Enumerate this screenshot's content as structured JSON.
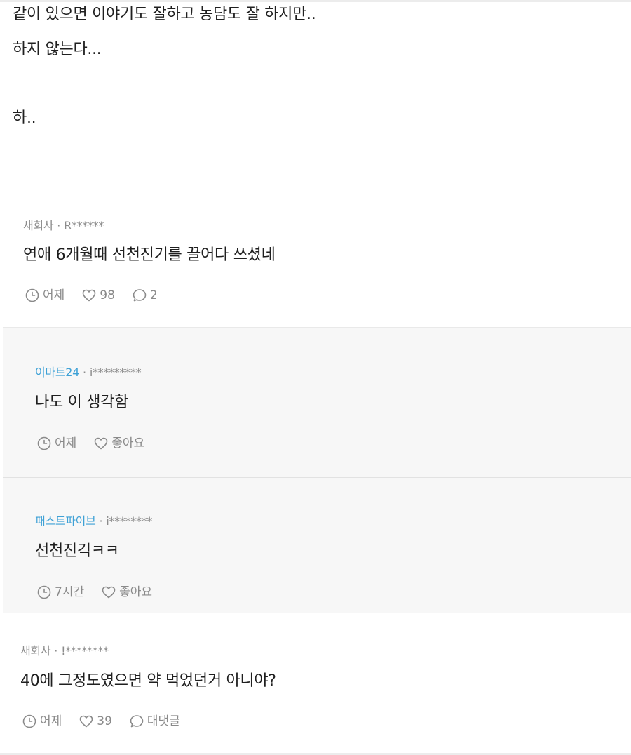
{
  "post": {
    "lines": [
      "같이 있으면 이야기도 잘하고 농담도 잘 하지만..",
      "하지 않는다...",
      "하.."
    ]
  },
  "comments": [
    {
      "company": "새회사",
      "separator": "·",
      "user": "R******",
      "text": "연애 6개월때 선천진기를 끌어다 쓰셨네",
      "time": "어제",
      "likes": "98",
      "replies": "2"
    },
    {
      "company": "이마트24",
      "separator": "·",
      "user": "i*********",
      "text": "나도 이 생각함",
      "time": "어제",
      "likes": "좋아요"
    },
    {
      "company": "패스트파이브",
      "separator": "·",
      "user": "i********",
      "text": "선천진긱ㅋㅋ",
      "time": "7시간",
      "likes": "좋아요"
    },
    {
      "company": "새회사",
      "separator": "·",
      "user": "!********",
      "text": "40에 그정도였으면 약 먹었던거 아니야?",
      "time": "어제",
      "likes": "39",
      "replies": "대댓글"
    }
  ],
  "colors": {
    "company_link": "#3ea1d6",
    "meta_gray": "#8c8c8c",
    "reply_background": "#f7f7f7"
  },
  "icons": {
    "time": "clock-icon",
    "like": "heart-icon",
    "reply": "speech-bubble-icon"
  }
}
